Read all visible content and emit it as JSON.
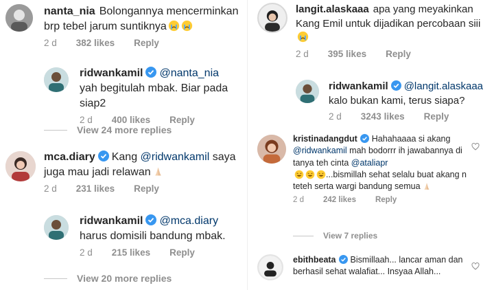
{
  "left": {
    "c1": {
      "user": "nanta_nia",
      "text": "Bolongannya mencerminkan brp tebel jarum suntiknya",
      "emoji": "😭😭",
      "time": "2 d",
      "likes": "382 likes",
      "reply": "Reply"
    },
    "r1": {
      "user": "ridwankamil",
      "mention": "@nanta_nia",
      "text": " yah begitulah mbak. Biar pada siap2",
      "time": "2 d",
      "likes": "400 likes",
      "reply": "Reply"
    },
    "more1": "View 24 more replies",
    "c2": {
      "user": "mca.diary",
      "pre": "Kang ",
      "mention": "@ridwankamil",
      "text": " saya juga mau jadi relawan",
      "emoji": "🙏🏻",
      "time": "2 d",
      "likes": "231 likes",
      "reply": "Reply"
    },
    "r2": {
      "user": "ridwankamil",
      "mention": "@mca.diary",
      "text": " harus domisili bandung mbak.",
      "time": "2 d",
      "likes": "215 likes",
      "reply": "Reply"
    },
    "more2": "View 20 more replies"
  },
  "right": {
    "c1": {
      "user": "langit.alaskaaa",
      "text": "apa yang meyakinkan Kang Emil untuk dijadikan percobaan siii",
      "emoji": "😭",
      "time": "2 d",
      "likes": "395 likes",
      "reply": "Reply"
    },
    "r1": {
      "user": "ridwankamil",
      "mention": "@langit.alaskaaa",
      "text": " kalo bukan kami, terus siapa?",
      "time": "2 d",
      "likes": "3243 likes",
      "reply": "Reply"
    },
    "c2": {
      "user": "kristinadangdut",
      "pre": "Hahahaaaa si akang ",
      "mention": "@ridwankamil",
      "mid": " mah bodorrr ih jawabannya di tanya teh cinta ",
      "mention2": "@ataliapr",
      "emoji1": "🤣🤣🤣",
      "text": "...bismillah sehat selalu buat akang n teteh serta wargi bandung semua",
      "emoji2": "🙏🏻",
      "time": "2 d",
      "likes": "242 likes",
      "reply": "Reply"
    },
    "more": "View 7 replies",
    "c3": {
      "user": "ebithbeata",
      "text": "Bismillaah... lancar aman dan berhasil sehat walafiat... Insyaa Allah...",
      "time": "",
      "likes": "",
      "reply": ""
    }
  },
  "colors": {
    "text": "#262626",
    "muted": "#8e8e8e",
    "mention": "#00376b",
    "verified": "#3897f0"
  }
}
